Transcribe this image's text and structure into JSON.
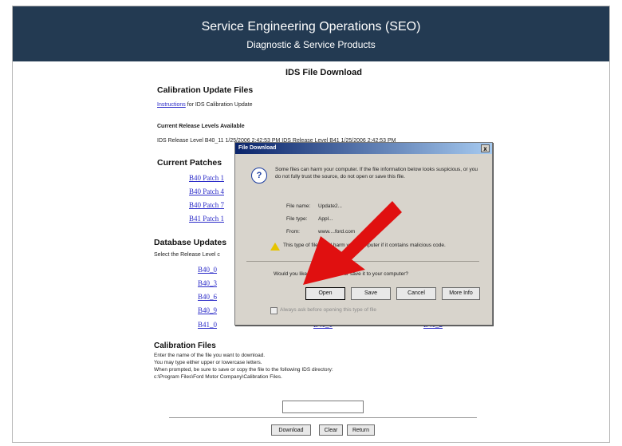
{
  "banner": {
    "title": "Service Engineering Operations (SEO)",
    "subtitle": "Diagnostic & Service Products"
  },
  "page": {
    "heading": "IDS File Download",
    "calibration_update": {
      "title": "Calibration Update Files",
      "instructions_link": "Instructions",
      "instructions_suffix": "for IDS Calibration Update"
    },
    "release_levels": {
      "title": "Current Release Levels Available",
      "text": "IDS Release Level B40_11 1/25/2006 2:42:53 PM   IDS Release Level B41   1/25/2006 2:42:53 PM"
    },
    "patches": {
      "title": "Current Patches",
      "items": [
        "B40 Patch 1",
        "B40 Patch 4",
        "B40 Patch 7",
        "B41 Patch 1"
      ]
    },
    "database_updates": {
      "title": "Database Updates",
      "instruction": "Select the Release Level c",
      "col1": [
        "B40_0",
        "B40_3",
        "B40_6",
        "B40_9",
        "B41_0"
      ],
      "col2_last": "B41_1",
      "col3_last": "B41_2"
    },
    "calibration_files": {
      "title": "Calibration Files",
      "lines": [
        "Enter the name of the file you want to download.",
        "You may type either upper or lowercase letters.",
        "When prompted, be sure to save or copy the file to the following IDS directory:",
        "c:\\Program Files\\Ford Motor Company\\Calibration Files."
      ],
      "input_value": ""
    },
    "buttons": {
      "download": "Download",
      "clear": "Clear",
      "return": "Return"
    }
  },
  "dialog": {
    "title": "File Download",
    "close": "x",
    "warning": "Some files can harm your computer. If the file information below looks suspicious, or you do not fully trust the source, do not open or save this file.",
    "file_name_label": "File name:",
    "file_name_value": "Update2...",
    "file_type_label": "File type:",
    "file_type_value": "Appl...",
    "from_label": "From:",
    "from_value": "www....ford.com",
    "harm_text": "This type of file could harm your computer if it contains malicious code.",
    "question": "Would you like to open the file or save it to your computer?",
    "buttons": {
      "open": "Open",
      "save": "Save",
      "cancel": "Cancel",
      "more_info": "More Info"
    },
    "checkbox_label": "Always ask before opening this type of file"
  },
  "annotation": {
    "arrow_color": "#e01010"
  }
}
